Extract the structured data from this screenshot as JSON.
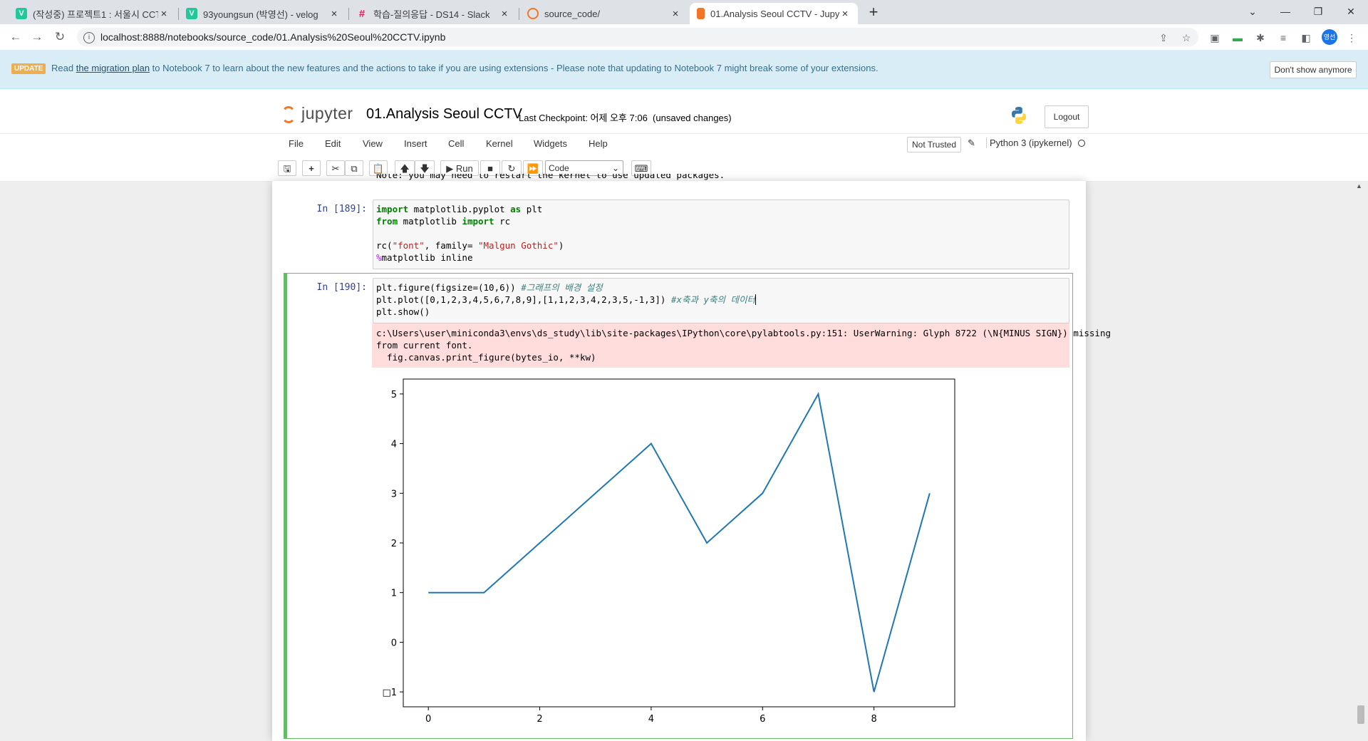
{
  "browser": {
    "tabs": [
      {
        "title": "(작성중) 프로젝트1 : 서울시 CCTV",
        "favicon": "velog-icon",
        "close": "×"
      },
      {
        "title": "93youngsun (박영선) - velog",
        "favicon": "velog-icon",
        "close": "×"
      },
      {
        "title": "학습-질의응답 - DS14 - Slack",
        "favicon": "slack-icon",
        "close": "×"
      },
      {
        "title": "source_code/",
        "favicon": "jupyter-icon",
        "close": "×"
      },
      {
        "title": "01.Analysis Seoul CCTV - Jupyter",
        "favicon": "notebook-icon",
        "close": "×"
      }
    ],
    "new_tab": "+",
    "url": "localhost:8888/notebooks/source_code/01.Analysis%20Seoul%20CCTV.ipynb",
    "profile_initials": "영선"
  },
  "notification": {
    "badge": "UPDATE",
    "text_before": "Read ",
    "link": "the migration plan",
    "text_after": " to Notebook 7 to learn about the new features and the actions to take if you are using extensions - Please note that updating to Notebook 7 might break some of your extensions.",
    "dismiss": "Don't show anymore"
  },
  "header": {
    "logo_text": "jupyter",
    "notebook_title": "01.Analysis Seoul CCTV",
    "checkpoint": "Last Checkpoint: 어제 오후 7:06",
    "unsaved": "(unsaved changes)",
    "logout": "Logout"
  },
  "menubar": {
    "items": [
      "File",
      "Edit",
      "View",
      "Insert",
      "Cell",
      "Kernel",
      "Widgets",
      "Help"
    ],
    "trusted": "Not Trusted",
    "kernel": "Python 3 (ipykernel)"
  },
  "toolbar": {
    "run_label": "Run",
    "cell_type": "Code"
  },
  "cells": {
    "partial_output": "Note: you may need to restart the kernel to use updated packages.",
    "cell1": {
      "prompt": "In [189]:",
      "lines": [
        {
          "kw1": "import",
          "a": " matplotlib.pyplot ",
          "kw2": "as",
          "b": " plt"
        },
        {
          "kw1": "from",
          "a": " matplotlib ",
          "kw2": "import",
          "b": " rc"
        },
        {
          "line": ""
        },
        {
          "a": "rc(",
          "s1": "\"font\"",
          "b": ", family= ",
          "s2": "\"Malgun Gothic\"",
          "c": ")"
        },
        {
          "op": "%",
          "rest": "matplotlib inline"
        }
      ]
    },
    "cell2": {
      "prompt": "In [190]:",
      "line1_code": "plt.figure(figsize=(10,6)) ",
      "line1_comment": "#그래프의 배경 설정",
      "line2_code": "plt.plot([0,1,2,3,4,5,6,7,8,9],[1,1,2,3,4,2,3,5,-1,3]) ",
      "line2_comment": "#x축과 y축의 데이터",
      "line3_code": "plt.show()",
      "stderr": [
        "c:\\Users\\user\\miniconda3\\envs\\ds_study\\lib\\site-packages\\IPython\\core\\pylabtools.py:151: UserWarning: Glyph 8722 (\\N{MINUS SIGN}) missing",
        "from current font.",
        "  fig.canvas.print_figure(bytes_io, **kw)"
      ]
    }
  },
  "chart_data": {
    "type": "line",
    "x": [
      0,
      1,
      2,
      3,
      4,
      5,
      6,
      7,
      8,
      9
    ],
    "series": [
      {
        "values": [
          1,
          1,
          2,
          3,
          4,
          2,
          3,
          5,
          -1,
          3
        ],
        "color": "#1f77b4"
      }
    ],
    "xticks": [
      "0",
      "2",
      "4",
      "6",
      "8"
    ],
    "yticks": [
      "5",
      "4",
      "3",
      "2",
      "1",
      "0",
      "□1"
    ],
    "xlim": [
      -0.45,
      9.45
    ],
    "ylim": [
      -1.3,
      5.3
    ]
  }
}
